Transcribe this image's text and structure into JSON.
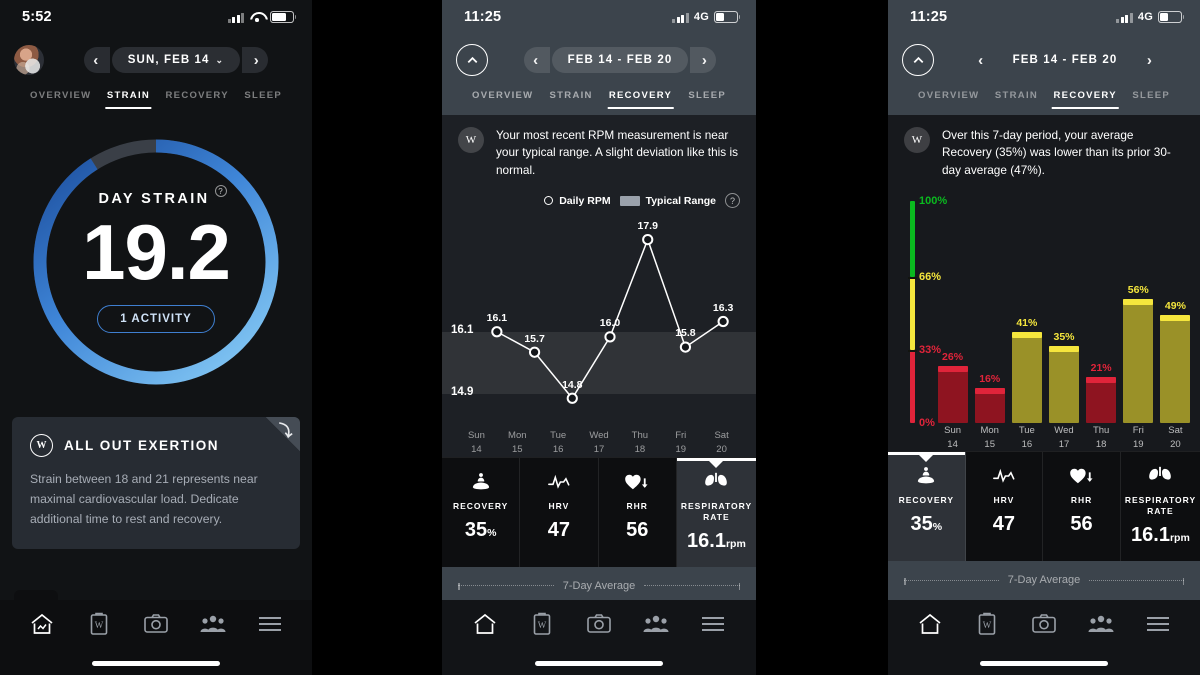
{
  "phone1": {
    "status": {
      "time": "5:52",
      "network": "",
      "icons": [
        "signal-bars",
        "wifi",
        "battery"
      ]
    },
    "nav": {
      "date_label": "SUN, FEB 14",
      "prev": "‹",
      "next": "›",
      "chevron": "⌄",
      "tabs": [
        {
          "label": "OVERVIEW",
          "active": false
        },
        {
          "label": "STRAIN",
          "active": true
        },
        {
          "label": "RECOVERY",
          "active": false
        },
        {
          "label": "SLEEP",
          "active": false
        }
      ]
    },
    "ring": {
      "title": "DAY STRAIN",
      "help": "?",
      "value": "19.2",
      "activity_label": "1 ACTIVITY",
      "progress_pct": 91,
      "arc_colors": {
        "start": "#7cc4f2",
        "end": "#1d4f9e",
        "track": "#3a3f47"
      }
    },
    "card": {
      "logo": "W",
      "title": "ALL OUT EXERTION",
      "body": "Strain between 18 and 21 represents near maximal cardiovascular load. Dedicate additional time to rest and recovery.",
      "fold_glyph": "⤵"
    },
    "bottom_nav": [
      {
        "name": "home",
        "active": true
      },
      {
        "name": "journal",
        "active": false
      },
      {
        "name": "camera",
        "active": false
      },
      {
        "name": "community",
        "active": false
      },
      {
        "name": "menu",
        "active": false
      }
    ]
  },
  "phone2": {
    "status": {
      "time": "11:25",
      "network": "4G"
    },
    "nav": {
      "date_label": "FEB 14 - FEB 20",
      "prev": "‹",
      "next": "›",
      "tabs": [
        {
          "label": "OVERVIEW",
          "active": false
        },
        {
          "label": "STRAIN",
          "active": false
        },
        {
          "label": "RECOVERY",
          "active": true
        },
        {
          "label": "SLEEP",
          "active": false
        }
      ]
    },
    "message": {
      "logo": "W",
      "text": "Your most recent RPM measurement is near your typical range. A slight deviation like this is normal."
    },
    "legend": {
      "series_label": "Daily RPM",
      "range_label": "Typical Range",
      "help": "?"
    },
    "metrics": [
      {
        "name": "RECOVERY",
        "value": "35",
        "unit": "%",
        "icon": "meditation-icon",
        "selected": false
      },
      {
        "name": "HRV",
        "value": "47",
        "unit": "",
        "icon": "hrv-icon",
        "selected": false
      },
      {
        "name": "RHR",
        "value": "56",
        "unit": "",
        "icon": "heart-down-icon",
        "selected": false
      },
      {
        "name": "RESPIRATORY RATE",
        "value": "16.1",
        "unit": "rpm",
        "icon": "lungs-icon",
        "selected": true
      }
    ],
    "average_label": "7-Day Average"
  },
  "phone3": {
    "status": {
      "time": "11:25",
      "network": "4G"
    },
    "nav": {
      "date_label": "FEB 14 - FEB 20",
      "prev": "‹",
      "next": "›",
      "tabs": [
        {
          "label": "OVERVIEW",
          "active": false
        },
        {
          "label": "STRAIN",
          "active": false
        },
        {
          "label": "RECOVERY",
          "active": true
        },
        {
          "label": "SLEEP",
          "active": false
        }
      ]
    },
    "message": {
      "logo": "W",
      "text": "Over this 7-day period, your average Recovery (35%) was lower than its prior 30-day average (47%)."
    },
    "metrics": [
      {
        "name": "RECOVERY",
        "value": "35",
        "unit": "%",
        "icon": "meditation-icon",
        "selected": true
      },
      {
        "name": "HRV",
        "value": "47",
        "unit": "",
        "icon": "hrv-icon",
        "selected": false
      },
      {
        "name": "RHR",
        "value": "56",
        "unit": "",
        "icon": "heart-down-icon",
        "selected": false
      },
      {
        "name": "RESPIRATORY RATE",
        "value": "16.1",
        "unit": "rpm",
        "icon": "lungs-icon",
        "selected": false
      }
    ],
    "average_label": "7-Day Average"
  },
  "chart_data": [
    {
      "type": "line",
      "title": "Daily RPM",
      "xlabel": "",
      "ylabel": "",
      "categories": [
        "Sun 14",
        "Mon 15",
        "Tue 16",
        "Wed 17",
        "Thu 18",
        "Fri 19",
        "Sat 20"
      ],
      "day_names": [
        "Sun",
        "Mon",
        "Tue",
        "Wed",
        "Thu",
        "Fri",
        "Sat"
      ],
      "day_numbers": [
        "14",
        "15",
        "16",
        "17",
        "18",
        "19",
        "20"
      ],
      "values": [
        16.1,
        15.7,
        14.8,
        16.0,
        17.9,
        15.8,
        16.3
      ],
      "point_labels": [
        "16.1",
        "15.7",
        "14.8",
        "16.0",
        "17.9",
        "15.8",
        "16.3"
      ],
      "typical_range": {
        "low": 14.9,
        "high": 16.1,
        "low_label": "14.9",
        "high_label": "16.1"
      },
      "ylim": [
        14.2,
        18.4
      ],
      "grid": false,
      "legend": [
        "Daily RPM",
        "Typical Range"
      ],
      "legend_position": "top-right",
      "series_color": "#ffffff",
      "band_color": "#9aa1ab"
    },
    {
      "type": "bar",
      "title": "Recovery",
      "xlabel": "",
      "ylabel": "%",
      "categories": [
        "Sun 14",
        "Mon 15",
        "Tue 16",
        "Wed 17",
        "Thu 18",
        "Fri 19",
        "Sat 20"
      ],
      "day_names": [
        "Sun",
        "Mon",
        "Tue",
        "Wed",
        "Thu",
        "Fri",
        "Sat"
      ],
      "day_numbers": [
        "14",
        "15",
        "16",
        "17",
        "18",
        "19",
        "20"
      ],
      "values": [
        26,
        16,
        41,
        35,
        21,
        56,
        49
      ],
      "bar_labels": [
        "26%",
        "16%",
        "41%",
        "35%",
        "21%",
        "56%",
        "49%"
      ],
      "bar_zones": [
        "red",
        "red",
        "yellow",
        "yellow",
        "red",
        "yellow",
        "yellow"
      ],
      "ylim": [
        0,
        100
      ],
      "grid": false,
      "axis_ticks": [
        {
          "label": "100%",
          "value": 100,
          "color": "#0aba1f"
        },
        {
          "label": "66%",
          "value": 66,
          "color": "#f5e63d"
        },
        {
          "label": "33%",
          "value": 33,
          "color": "#e0243a"
        },
        {
          "label": "0%",
          "value": 0,
          "color": "#e0243a"
        }
      ],
      "zone_colors": {
        "green": "#0aba1f",
        "yellow": "#f5e63d",
        "yellow_bar": "#9a9128",
        "red": "#e0243a",
        "red_bar": "#8e1420"
      }
    }
  ]
}
